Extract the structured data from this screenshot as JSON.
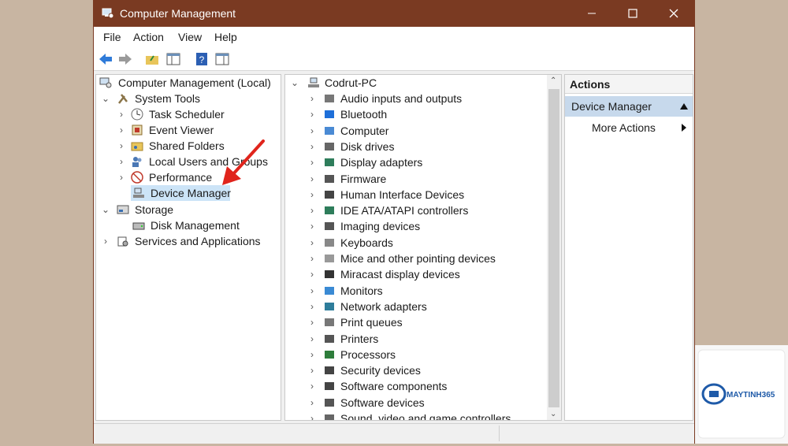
{
  "window": {
    "title": "Computer Management"
  },
  "menu": [
    "File",
    "Action",
    "View",
    "Help"
  ],
  "tree": {
    "root": "Computer Management (Local)",
    "system_tools": "System Tools",
    "task_scheduler": "Task Scheduler",
    "event_viewer": "Event Viewer",
    "shared_folders": "Shared Folders",
    "local_users": "Local Users and Groups",
    "performance": "Performance",
    "device_manager": "Device Manager",
    "storage": "Storage",
    "disk_management": "Disk Management",
    "services": "Services and Applications"
  },
  "devices": {
    "computer_name": "Codrut-PC",
    "categories": [
      "Audio inputs and outputs",
      "Bluetooth",
      "Computer",
      "Disk drives",
      "Display adapters",
      "Firmware",
      "Human Interface Devices",
      "IDE ATA/ATAPI controllers",
      "Imaging devices",
      "Keyboards",
      "Mice and other pointing devices",
      "Miracast display devices",
      "Monitors",
      "Network adapters",
      "Print queues",
      "Printers",
      "Processors",
      "Security devices",
      "Software components",
      "Software devices",
      "Sound, video and game controllers"
    ]
  },
  "actions": {
    "header": "Actions",
    "section": "Device Manager",
    "more": "More Actions"
  },
  "watermark": {
    "brand": "MAYTINH365"
  },
  "colors": {
    "titlebar": "#7a3a22",
    "selection": "#cce4f7",
    "background": "#c8b5a2",
    "arrow": "#e0241c"
  }
}
